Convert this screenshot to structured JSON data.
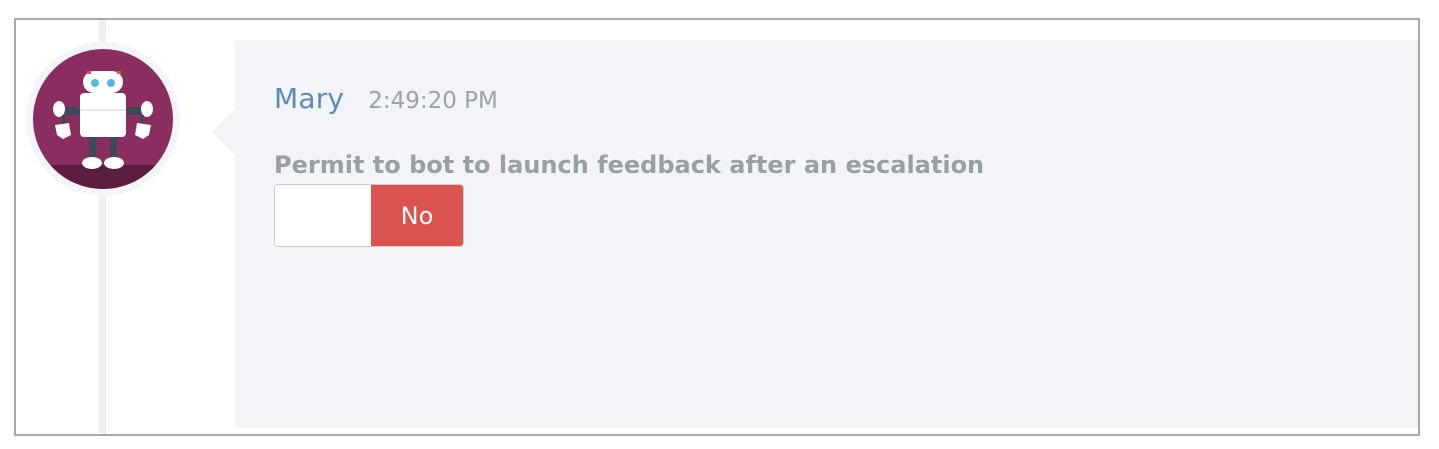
{
  "message": {
    "author": "Mary",
    "time": "2:49:20 PM",
    "avatar_icon": "robot-avatar-icon",
    "question": "Permit to bot to launch feedback after an escalation",
    "toggle": {
      "value_label": "No",
      "state": "off",
      "value_color": "#d9534f"
    }
  },
  "colors": {
    "author": "#5d8ab9",
    "card_background": "#f3f4f8",
    "avatar_background": "#8a2e62"
  }
}
